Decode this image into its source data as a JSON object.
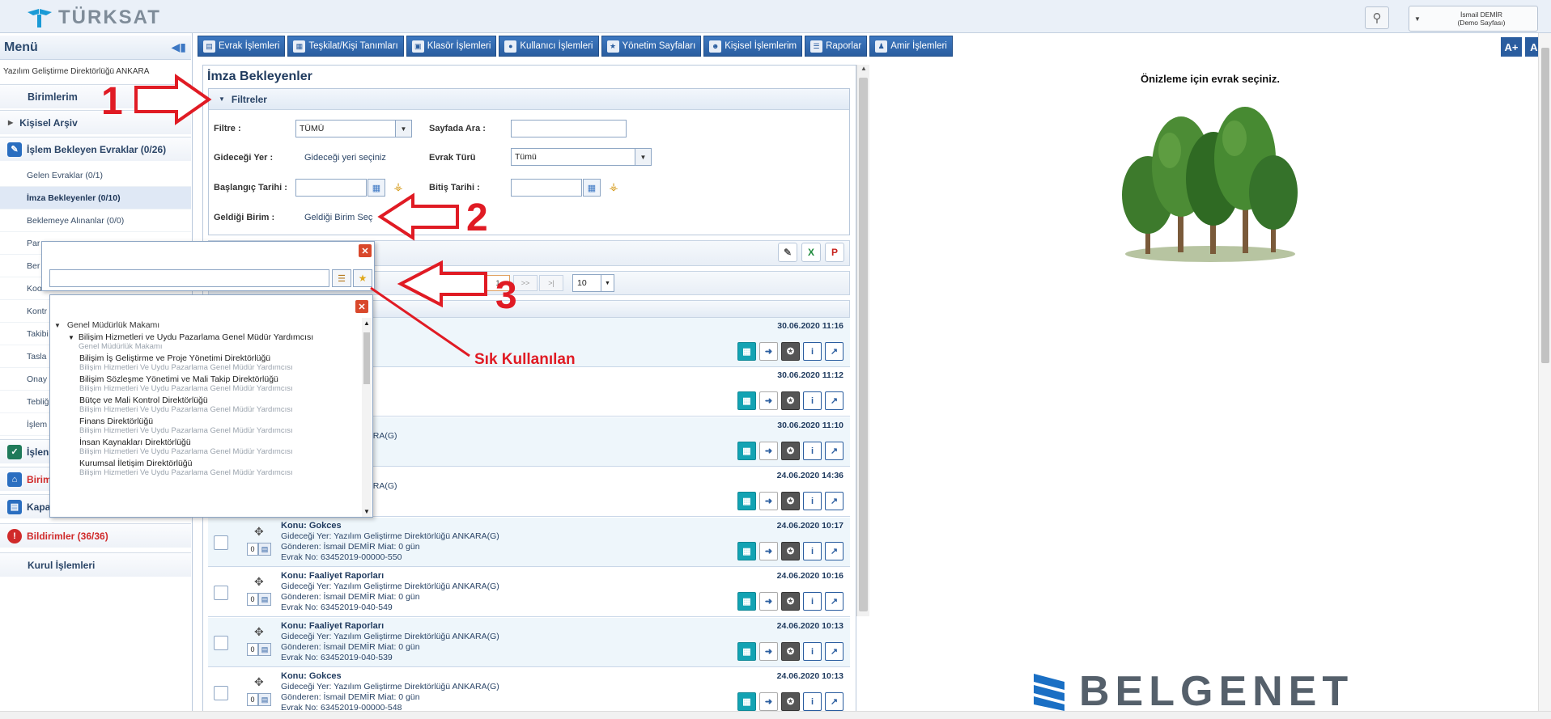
{
  "brand": {
    "logo_text": "TÜRKSAT"
  },
  "user": {
    "name": "İsmail DEMİR",
    "role": "(Demo Sayfası)"
  },
  "sidebar": {
    "title": "Menü",
    "org": "Yazılım Geliştirme Direktörlüğü ANKARA",
    "sections": [
      "Birimlerim",
      "Kişisel Arşiv",
      "İşlem Bekleyen Evraklar (0/26)"
    ],
    "items": [
      "Gelen Evraklar (0/1)",
      "İmza Bekleyenler (0/10)",
      "Beklemeye Alınanlar (0/0)",
      "Par",
      "Ber",
      "Koo",
      "Kontr",
      "Takibi",
      "Tasla",
      "Onay",
      "Tebliğ",
      "İşlem"
    ],
    "bottom_sections": [
      "İşlen",
      "Birim",
      "Kapa",
      "Bildirimler (36/36)",
      "Kurul İşlemleri"
    ]
  },
  "nav": {
    "items": [
      "Evrak İşlemleri",
      "Teşkilat/Kişi Tanımları",
      "Klasör İşlemleri",
      "Kullanıcı İşlemleri",
      "Yönetim Sayfaları",
      "Kişisel İşlemlerim",
      "Raporlar",
      "Amir İşlemleri"
    ],
    "font_up": "A+",
    "font_down": "A-"
  },
  "page": {
    "title": "İmza Bekleyenler"
  },
  "filters": {
    "title": "Filtreler",
    "filter_label": "Filtre :",
    "filter_value": "TÜMÜ",
    "search_label": "Sayfada Ara :",
    "destination_label": "Gideceği Yer :",
    "destination_value": "Gideceği yeri seçiniz",
    "doc_type_label": "Evrak Türü",
    "doc_type_value": "Tümü",
    "start_date_label": "Başlangıç Tarihi :",
    "end_date_label": "Bitiş Tarihi :",
    "source_unit_label": "Geldiği Birim :",
    "source_unit_value": "Geldiği Birim Seç"
  },
  "pager": {
    "current": "1",
    "next": ">>",
    "last": ">|",
    "page_size": "10"
  },
  "documents": [
    {
      "subject": "",
      "line2": "şkanlığı(G)",
      "line3": "Miat: 0 gün",
      "line4": "3456-563",
      "date": "30.06.2020 11:16"
    },
    {
      "subject": "",
      "line2": "şkanlığı(G)",
      "line3": "Miat: 0 gün",
      "line4": "0000-562",
      "date": "30.06.2020 11:12"
    },
    {
      "subject": "arı",
      "line2": "tirme Direktörlüğü ANKARA(G)",
      "line3": "Miat: 0 gün",
      "line4": "0-561",
      "date": "30.06.2020 11:10"
    },
    {
      "subject": "",
      "line2": "tirme Direktörlüğü ANKARA(G)",
      "line3": "Miat: 0 gün",
      "line4": "-551",
      "date": "24.06.2020 14:36"
    },
    {
      "subject": "Konu: Gokces",
      "line2": "Gideceği Yer: Yazılım Geliştirme Direktörlüğü ANKARA(G)",
      "line3": "Gönderen: İsmail DEMİR Miat: 0 gün",
      "line4": "Evrak No: 63452019-00000-550",
      "date": "24.06.2020 10:17"
    },
    {
      "subject": "Konu: Faaliyet Raporları",
      "line2": "Gideceği Yer: Yazılım Geliştirme Direktörlüğü ANKARA(G)",
      "line3": "Gönderen: İsmail DEMİR Miat: 0 gün",
      "line4": "Evrak No: 63452019-040-549",
      "date": "24.06.2020 10:16"
    },
    {
      "subject": "Konu: Faaliyet Raporları",
      "line2": "Gideceği Yer: Yazılım Geliştirme Direktörlüğü ANKARA(G)",
      "line3": "Gönderen: İsmail DEMİR Miat: 0 gün",
      "line4": "Evrak No: 63452019-040-539",
      "date": "24.06.2020 10:13"
    },
    {
      "subject": "Konu: Gokces",
      "line2": "Gideceği Yer: Yazılım Geliştirme Direktörlüğü ANKARA(G)",
      "line3": "Gönderen: İsmail DEMİR Miat: 0 gün",
      "line4": "Evrak No: 63452019-00000-548",
      "date": "24.06.2020 10:13"
    }
  ],
  "row_counter": "0",
  "preview": {
    "message": "Önizleme için evrak seçiniz.",
    "watermark": "BELGENET"
  },
  "tree": {
    "root": "Genel Müdürlük Makamı",
    "items": [
      {
        "name": "Bilişim Hizmetleri ve Uydu Pazarlama Genel Müdür Yardımcısı",
        "parent": "Genel Müdürlük Makamı"
      },
      {
        "name": "Bilişim İş Geliştirme ve Proje Yönetimi Direktörlüğü",
        "parent": "Bilişim Hizmetleri Ve Uydu Pazarlama Genel Müdür Yardımcısı"
      },
      {
        "name": "Bilişim Sözleşme Yönetimi ve Mali Takip Direktörlüğü",
        "parent": "Bilişim Hizmetleri Ve Uydu Pazarlama Genel Müdür Yardımcısı"
      },
      {
        "name": "Bütçe ve Mali Kontrol Direktörlüğü",
        "parent": "Bilişim Hizmetleri Ve Uydu Pazarlama Genel Müdür Yardımcısı"
      },
      {
        "name": "Finans Direktörlüğü",
        "parent": "Bilişim Hizmetleri Ve Uydu Pazarlama Genel Müdür Yardımcısı"
      },
      {
        "name": "İnsan Kaynakları Direktörlüğü",
        "parent": "Bilişim Hizmetleri Ve Uydu Pazarlama Genel Müdür Yardımcısı"
      },
      {
        "name": "Kurumsal İletişim Direktörlüğü",
        "parent": "Bilişim Hizmetleri Ve Uydu Pazarlama Genel Müdür Yardımcısı"
      }
    ]
  },
  "annotations": {
    "n1": "1",
    "n2": "2",
    "n3": "3",
    "label": "Sık Kullanılan",
    "color": "#e01b24"
  },
  "colors": {
    "nav_blue": "#2a5d9f",
    "accent_red": "#e01b24",
    "panel_border": "#b9c8db"
  }
}
